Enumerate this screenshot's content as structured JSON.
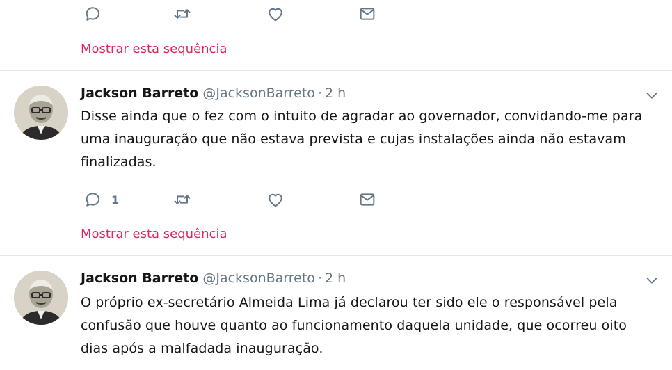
{
  "colors": {
    "accent_link": "#e0245e",
    "secondary_text": "#657786",
    "divider": "#e1e8ed",
    "icon": "#657786"
  },
  "tweets": [
    {
      "actions": {
        "reply_count": "",
        "retweet_count": "",
        "like_count": ""
      },
      "thread_link": "Mostrar esta sequência"
    },
    {
      "author": {
        "name": "Jackson Barreto",
        "handle": "@JacksonBarreto"
      },
      "separator": "·",
      "time": "2 h",
      "text": "Disse ainda que o fez com o intuito de agradar ao governador, convidando-me para uma inauguração que não estava prevista e cujas instalações ainda não estavam finalizadas.",
      "actions": {
        "reply_count": "1",
        "retweet_count": "",
        "like_count": ""
      },
      "thread_link": "Mostrar esta sequência"
    },
    {
      "author": {
        "name": "Jackson Barreto",
        "handle": "@JacksonBarreto"
      },
      "separator": "·",
      "time": "2 h",
      "text": "O próprio ex-secretário Almeida Lima já declarou ter sido ele o responsável pela confusão que houve quanto ao funcionamento daquela unidade, que ocorreu oito dias após a malfadada inauguração."
    }
  ],
  "icons": [
    "reply-icon",
    "retweet-icon",
    "like-icon",
    "direct-message-icon",
    "chevron-down-icon"
  ]
}
